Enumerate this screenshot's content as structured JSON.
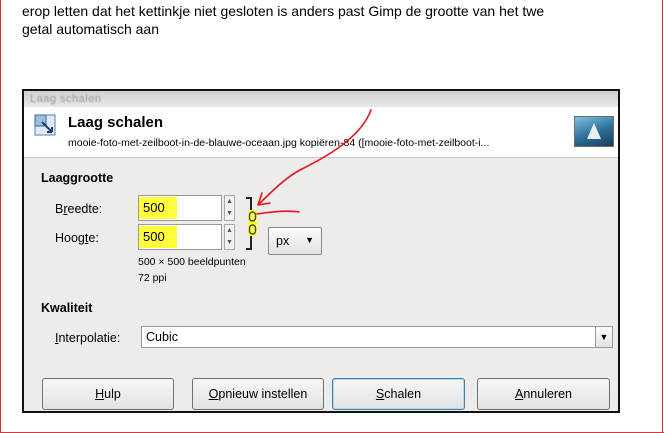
{
  "intro": {
    "line1": "erop letten dat het kettinkje niet gesloten is anders past Gimp de grootte van het twe",
    "line2": "getal automatisch aan"
  },
  "dialog": {
    "window_title": "Laag schalen",
    "header_title": "Laag schalen",
    "header_subtitle": "mooie-foto-met-zeilboot-in-de-blauwe-oceaan.jpg kopiëren-84 ([mooie-foto-met-zeilboot-i...",
    "layer_size_title": "Laaggrootte",
    "width_label_pre": "B",
    "width_label_u": "r",
    "width_label_post": "eedte:",
    "width_value": "500",
    "height_label_pre": "Hoog",
    "height_label_u": "t",
    "height_label_post": "e:",
    "height_value": "500",
    "unit": "px",
    "dimensions_text": "500 × 500 beeldpunten",
    "resolution_text": "72 ppi",
    "quality_title": "Kwaliteit",
    "interp_label_pre": "",
    "interp_label_u": "I",
    "interp_label_post": "nterpolatie:",
    "interp_value": "Cubic",
    "buttons": {
      "help_u": "H",
      "help_rest": "ulp",
      "reset_u": "O",
      "reset_rest": "pnieuw instellen",
      "scale_u": "S",
      "scale_rest": "chalen",
      "cancel_u": "A",
      "cancel_rest": "nnuleren"
    }
  },
  "colors": {
    "highlight": "#ffff3d",
    "annotation": "#e3161b",
    "page_border": "#d0383c"
  }
}
